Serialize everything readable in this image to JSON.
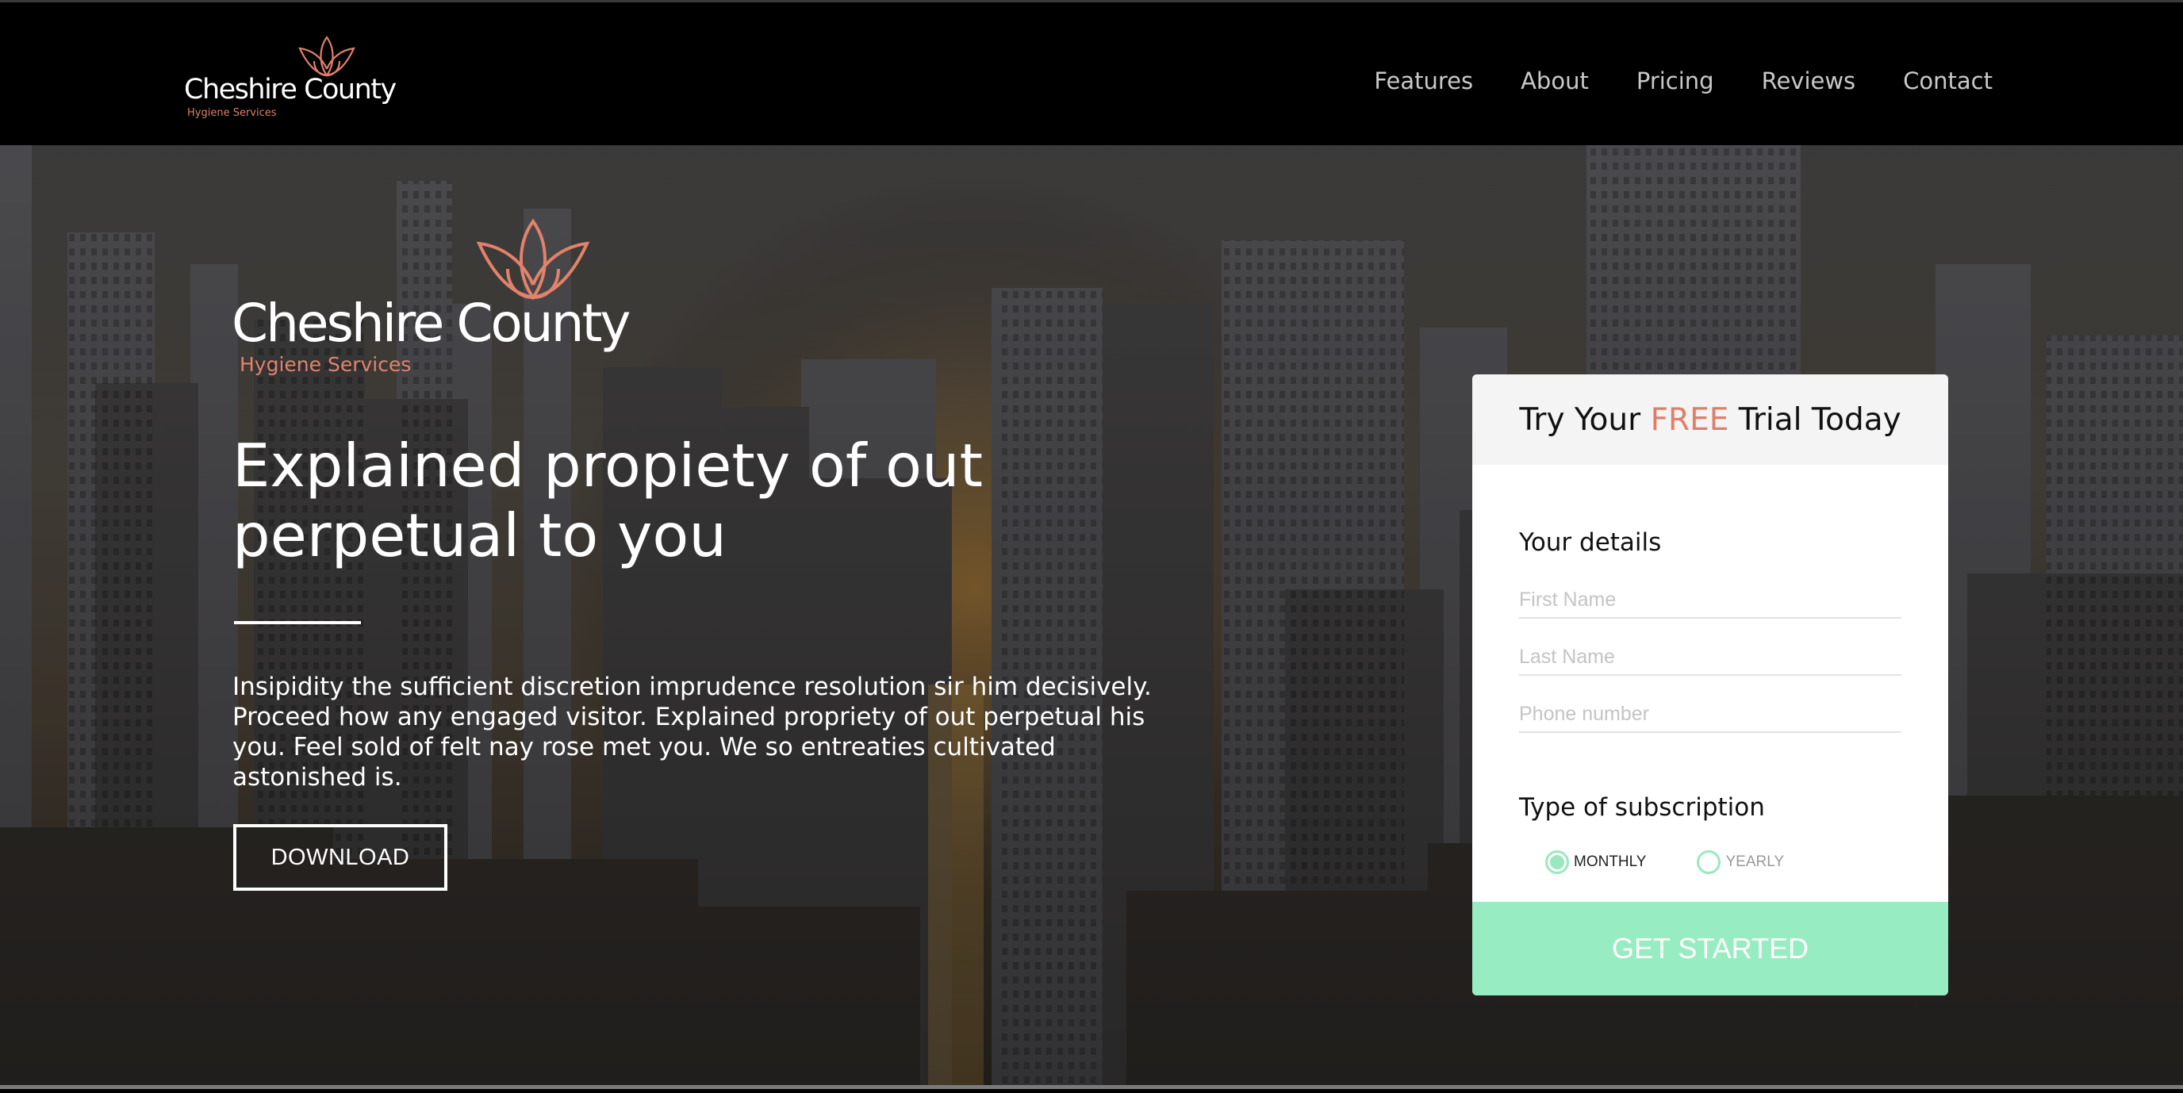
{
  "brand": {
    "name": "Cheshire County",
    "tagline": "Hygiene Services",
    "accent_color": "#e07f68"
  },
  "nav": {
    "items": [
      "Features",
      "About",
      "Pricing",
      "Reviews",
      "Contact"
    ]
  },
  "hero": {
    "logo_name": "Cheshire County",
    "logo_tagline": "Hygiene Services",
    "headline": "Explained propiety of out perpetual to you",
    "body": "Insipidity the sufficient discretion imprudence resolution sir him decisively. Proceed how any engaged visitor. Explained propriety of out perpetual his you. Feel sold of felt nay rose met you. We so entreaties cultivated astonished is.",
    "download_label": "DOWNLOAD",
    "background_icon": "city-skyline-photo"
  },
  "trial": {
    "title_pre": "Try Your ",
    "title_free": "FREE",
    "title_post": " Trial Today",
    "details_heading": "Your details",
    "fields": {
      "first_name_placeholder": "First Name",
      "last_name_placeholder": "Last Name",
      "phone_placeholder": "Phone number"
    },
    "subscription_heading": "Type of subscription",
    "options": [
      {
        "label": "MONTHLY",
        "selected": true
      },
      {
        "label": "YEARLY",
        "selected": false
      }
    ],
    "cta_label": "GET STARTED",
    "cta_color": "#98ecc1"
  }
}
